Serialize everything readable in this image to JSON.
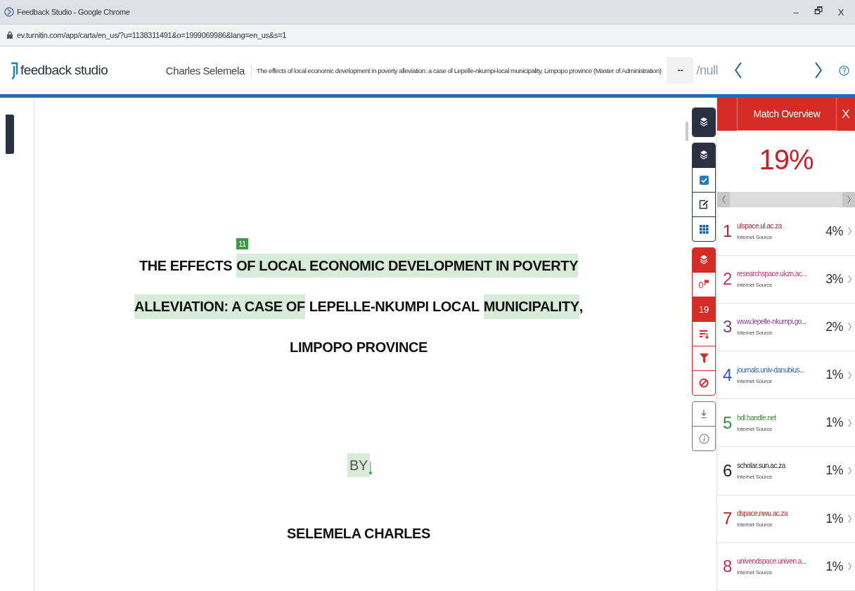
{
  "window": {
    "title": "Feedback Studio - Google Chrome",
    "controls": [
      "–",
      "🗗",
      "X"
    ]
  },
  "address_bar": {
    "url": "ev.turnitin.com/app/carta/en_us/?u=1138311491&o=1999069986&lang=en_us&s=1"
  },
  "header": {
    "logo": "feedback studio",
    "author": "Charles Selemela",
    "paper_title": "The effects of local economic development in poverty alleviation: a case of Lepelle-nkumpi-local municipality, Limpopo province (Master of Administration)",
    "page_field": "--",
    "page_total": "/null"
  },
  "document": {
    "badge": "11",
    "title_lines": [
      [
        {
          "text": "THE EFFECTS",
          "highlighted": false
        },
        {
          "text": "OF LOCAL ECONOMIC DEVELOPMENT IN POVERTY",
          "highlighted": true
        }
      ],
      [
        {
          "text": "ALLEVIATION: A CASE OF",
          "highlighted": true
        },
        {
          "text": "LEPELLE-NKUMPI LOCAL",
          "highlighted": false
        },
        {
          "text": "MUNICIPALITY",
          "highlighted": true
        },
        {
          "text": ",",
          "highlighted": false
        }
      ],
      [
        {
          "text": "LIMPOPO PROVINCE",
          "highlighted": false
        }
      ]
    ],
    "by": {
      "text": "BY",
      "highlighted": true
    },
    "author": {
      "text": "SELEMELA CHARLES",
      "highlighted": false
    }
  },
  "toolbar": {
    "groups": [
      {
        "color": "#2a3140",
        "tools": [
          {
            "kind": "layers",
            "selected": true
          }
        ]
      },
      {
        "color": "#2a3140",
        "tools": [
          {
            "kind": "layers",
            "selected": true
          },
          {
            "kind": "checkbox",
            "checked": true
          },
          {
            "kind": "edit",
            "selected": false
          },
          {
            "kind": "grid",
            "selected": false
          }
        ]
      },
      {
        "color": "#d52b27",
        "tools": [
          {
            "kind": "layers",
            "selected": true
          },
          {
            "kind": "flag",
            "label": "0",
            "selected": false
          },
          {
            "kind": "count",
            "label": "19",
            "selected": true
          },
          {
            "kind": "sort",
            "selected": false
          },
          {
            "kind": "filter",
            "selected": false
          },
          {
            "kind": "ban",
            "selected": false
          }
        ]
      },
      {
        "color": "#777777",
        "tools": [
          {
            "kind": "download",
            "selected": false
          },
          {
            "kind": "info",
            "selected": false
          }
        ]
      }
    ]
  },
  "panel": {
    "title": "Match Overview",
    "close": "X",
    "score": "19%",
    "matches": [
      {
        "number": "1",
        "source": "ulspace.ul.ac.za",
        "type": "Internet Source",
        "percent": "4%",
        "color": "#a3283a"
      },
      {
        "number": "2",
        "source": "researchspace.ukzn.ac...",
        "type": "Internet Source",
        "percent": "3%",
        "color": "#c2306c"
      },
      {
        "number": "3",
        "source": "www.lepelle-nkumpi.go...",
        "type": "Internet Source",
        "percent": "2%",
        "color": "#7b3d8e"
      },
      {
        "number": "4",
        "source": "journals.univ-danubius...",
        "type": "Internet Source",
        "percent": "1%",
        "color": "#2d5ea6"
      },
      {
        "number": "5",
        "source": "hdl.handle.net",
        "type": "Internet Source",
        "percent": "1%",
        "color": "#3b8a3b"
      },
      {
        "number": "6",
        "source": "scholar.sun.ac.za",
        "type": "Internet Source",
        "percent": "1%",
        "color": "#222222"
      },
      {
        "number": "7",
        "source": "dspace.nwu.ac.za",
        "type": "Internet Source",
        "percent": "1%",
        "color": "#b3211f"
      },
      {
        "number": "8",
        "source": "univendspace.univen.a...",
        "type": "Internet Source",
        "percent": "1%",
        "color": "#c42a62"
      }
    ]
  }
}
